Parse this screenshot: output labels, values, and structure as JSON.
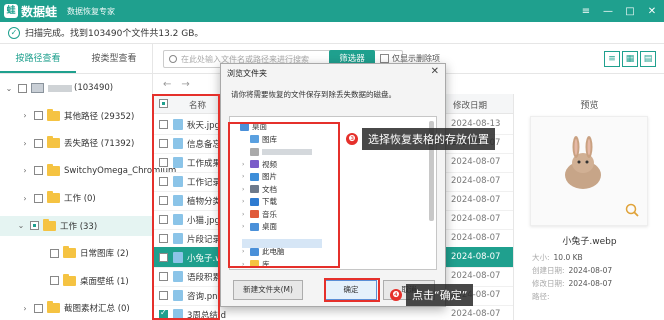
{
  "app": {
    "logo_text": "蛙",
    "name": "数据蛙",
    "subtitle": "数据恢复专家",
    "window_controls": [
      "≡",
      "—",
      "□",
      "✕"
    ]
  },
  "status": {
    "scan_text": "扫描完成。找到103490个文件共13.2 GB。"
  },
  "left_tabs": [
    {
      "label": "按路径查看",
      "active": true
    },
    {
      "label": "按类型查看",
      "active": false
    }
  ],
  "tree": [
    {
      "label": "(103490)",
      "level": 0,
      "type": "drive"
    },
    {
      "label": "其他路径 (29352)",
      "level": 1,
      "type": "folder"
    },
    {
      "label": "丢失路径 (71392)",
      "level": 1,
      "type": "folder"
    },
    {
      "label": "SwitchyOmega_Chromium",
      "level": 1,
      "type": "folder"
    },
    {
      "label": "工作 (0)",
      "level": 1,
      "type": "folder"
    },
    {
      "label": "工作 (33)",
      "level": 1,
      "type": "folder",
      "selected": true
    },
    {
      "label": "日常图库 (2)",
      "level": 2,
      "type": "folder"
    },
    {
      "label": "桌面壁纸 (1)",
      "level": 2,
      "type": "folder"
    },
    {
      "label": "截图素材汇总 (0)",
      "level": 1,
      "type": "folder"
    }
  ],
  "toolbar": {
    "search_placeholder": "在此处输入文件名或路径来进行搜索",
    "filter_label": "筛选器",
    "only_deleted_label": "仅显示删除项",
    "nav_back": "←",
    "nav_forward": "→"
  },
  "list": {
    "col_name": "名称",
    "col_date": "修改日期",
    "rows": [
      {
        "name": "秋天.jpg",
        "date": "2024-08-13",
        "checked": false,
        "selected": false
      },
      {
        "name": "信息备忘.t",
        "date": "2024-08-07",
        "checked": false,
        "selected": false
      },
      {
        "name": "工作成果分",
        "date": "2024-08-07",
        "checked": false,
        "selected": false
      },
      {
        "name": "工作记录表",
        "date": "2024-08-07",
        "checked": false,
        "selected": false
      },
      {
        "name": "植物分类.d",
        "date": "2024-08-07",
        "checked": false,
        "selected": false
      },
      {
        "name": "小猫.jpg",
        "date": "2024-08-07",
        "checked": false,
        "selected": false
      },
      {
        "name": "片段记录.t",
        "date": "2024-08-07",
        "checked": false,
        "selected": false
      },
      {
        "name": "小兔子.web",
        "date": "2024-08-07",
        "checked": false,
        "selected": true
      },
      {
        "name": "语段积累.d",
        "date": "2024-08-07",
        "checked": false,
        "selected": false
      },
      {
        "name": "咨询.png",
        "date": "2024-08-07",
        "checked": false,
        "selected": false
      },
      {
        "name": "3周总结.d",
        "date": "2024-08-07",
        "checked": true,
        "selected": false
      }
    ]
  },
  "preview": {
    "title": "预览",
    "file_name": "小兔子.webp",
    "meta": [
      {
        "label": "大小:",
        "value": "10.0 KB"
      },
      {
        "label": "创建日期:",
        "value": "2024-08-07"
      },
      {
        "label": "修改日期:",
        "value": "2024-08-07"
      },
      {
        "label": "路径:",
        "value": ""
      }
    ]
  },
  "dialog": {
    "title": "浏览文件夹",
    "close": "✕",
    "description": "请你将需要恢复的文件保存到除丢失数据的磁盘。",
    "tree": [
      {
        "label": "桌面",
        "arrow": "",
        "color": "#4a90d9"
      },
      {
        "label": "图库",
        "arrow": "",
        "color": "#5aa0e0"
      },
      {
        "label": "",
        "arrow": "",
        "color": "#aaaaaa"
      },
      {
        "label": "视频",
        "arrow": "›",
        "color": "#7a5cc9"
      },
      {
        "label": "图片",
        "arrow": "›",
        "color": "#3d8ed9"
      },
      {
        "label": "文档",
        "arrow": "›",
        "color": "#6d7a8c"
      },
      {
        "label": "下载",
        "arrow": "›",
        "color": "#2e7bd1"
      },
      {
        "label": "音乐",
        "arrow": "›",
        "color": "#e05a3a"
      },
      {
        "label": "桌面",
        "arrow": "›",
        "color": "#4a90d9"
      },
      {
        "label": "",
        "arrow": "",
        "color": "#f5c342"
      },
      {
        "label": "此电脑",
        "arrow": "›",
        "color": "#4a90d9"
      },
      {
        "label": "库",
        "arrow": "›",
        "color": "#f5c342"
      }
    ],
    "new_folder_label": "新建文件夹(M)",
    "ok_label": "确定",
    "cancel_label": "取消"
  },
  "annotations": {
    "step1_num": "❸",
    "step1_text": "选择恢复表格的存放位置",
    "step2_num": "❹",
    "step2_text": "点击“确定”",
    "color": "#e5302b"
  }
}
